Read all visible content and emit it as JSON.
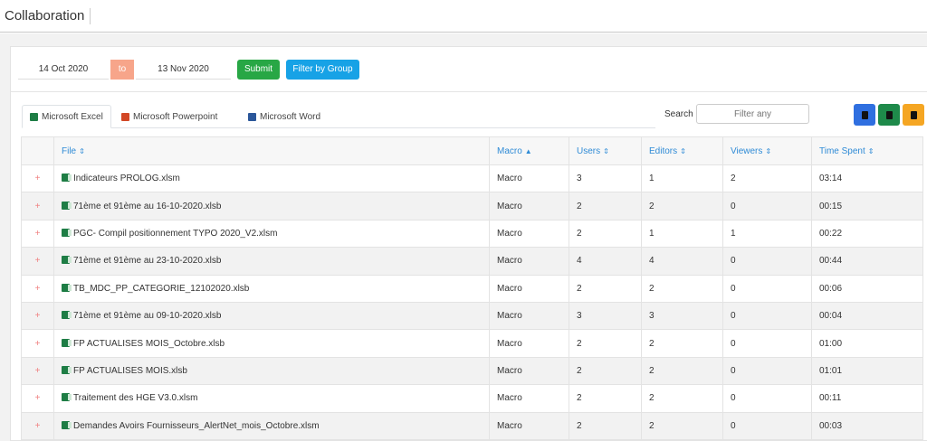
{
  "app": {
    "title": "Collaboration"
  },
  "filters": {
    "date_from": "14 Oct 2020",
    "to_label": "to",
    "date_to": "13 Nov 2020",
    "submit_label": "Submit",
    "filter_group_label": "Filter by Group"
  },
  "tabs": [
    {
      "label": "Microsoft Excel",
      "icon": "excel-icon",
      "color": "#1e7d45"
    },
    {
      "label": "Microsoft Powerpoint",
      "icon": "powerpoint-icon",
      "color": "#d24726"
    },
    {
      "label": "Microsoft Word",
      "icon": "word-icon",
      "color": "#2b579a"
    }
  ],
  "search": {
    "label": "Search",
    "placeholder": "Filter any"
  },
  "export_buttons": [
    {
      "name": "export-blue-button",
      "color": "#2f6fe0"
    },
    {
      "name": "export-green-button",
      "color": "#1e8a4a"
    },
    {
      "name": "export-orange-button",
      "color": "#f5a623"
    }
  ],
  "table": {
    "columns": [
      "File",
      "Macro",
      "Users",
      "Editors",
      "Viewers",
      "Time Spent"
    ],
    "sort_icons": [
      "⇕",
      "▲",
      "⇕",
      "⇕",
      "⇕",
      "⇕"
    ],
    "expand_symbol": "+",
    "rows": [
      {
        "file": "Indicateurs PROLOG.xlsm",
        "macro": "Macro",
        "users": "3",
        "editors": "1",
        "viewers": "2",
        "time": "03:14"
      },
      {
        "file": "71ème et 91ème au 16-10-2020.xlsb",
        "macro": "Macro",
        "users": "2",
        "editors": "2",
        "viewers": "0",
        "time": "00:15"
      },
      {
        "file": "PGC- Compil positionnement TYPO 2020_V2.xlsm",
        "macro": "Macro",
        "users": "2",
        "editors": "1",
        "viewers": "1",
        "time": "00:22"
      },
      {
        "file": "71ème et 91ème au 23-10-2020.xlsb",
        "macro": "Macro",
        "users": "4",
        "editors": "4",
        "viewers": "0",
        "time": "00:44"
      },
      {
        "file": "TB_MDC_PP_CATEGORIE_12102020.xlsb",
        "macro": "Macro",
        "users": "2",
        "editors": "2",
        "viewers": "0",
        "time": "00:06"
      },
      {
        "file": "71ème et 91ème au 09-10-2020.xlsb",
        "macro": "Macro",
        "users": "3",
        "editors": "3",
        "viewers": "0",
        "time": "00:04"
      },
      {
        "file": "FP ACTUALISES MOIS_Octobre.xlsb",
        "macro": "Macro",
        "users": "2",
        "editors": "2",
        "viewers": "0",
        "time": "01:00"
      },
      {
        "file": "FP ACTUALISES MOIS.xlsb",
        "macro": "Macro",
        "users": "2",
        "editors": "2",
        "viewers": "0",
        "time": "01:01"
      },
      {
        "file": "Traitement des HGE V3.0.xlsm",
        "macro": "Macro",
        "users": "2",
        "editors": "2",
        "viewers": "0",
        "time": "00:11"
      },
      {
        "file": "Demandes Avoirs Fournisseurs_AlertNet_mois_Octobre.xlsm",
        "macro": "Macro",
        "users": "2",
        "editors": "2",
        "viewers": "0",
        "time": "00:03"
      }
    ]
  }
}
